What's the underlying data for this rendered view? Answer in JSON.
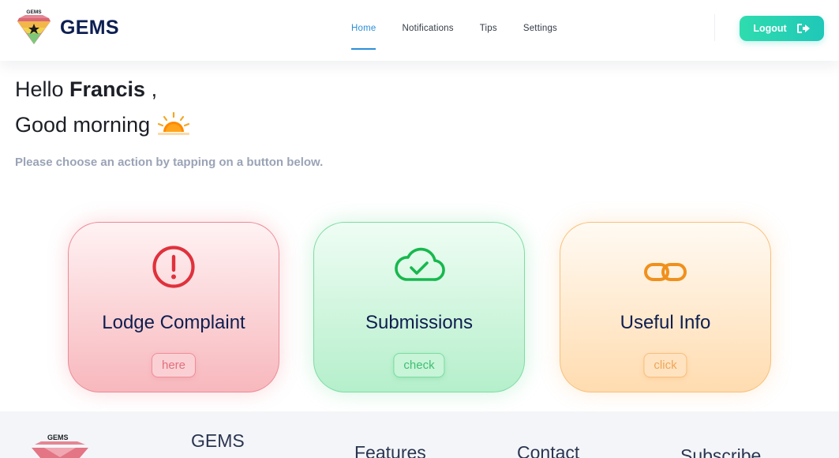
{
  "brand": {
    "logo_text": "GEMS",
    "name": "GEMS"
  },
  "nav": {
    "links": [
      {
        "label": "Home",
        "active": true
      },
      {
        "label": "Notifications",
        "active": false
      },
      {
        "label": "Tips",
        "active": false
      },
      {
        "label": "Settings",
        "active": false
      }
    ],
    "logout_label": "Logout",
    "logout_icon": "sign-out-icon"
  },
  "greeting": {
    "hello_prefix": "Hello ",
    "user_name": "Francis",
    "hello_suffix": " ,",
    "time_greeting": "Good morning",
    "time_icon": "sunrise-icon",
    "instruction": "Please choose an action by tapping on a button below."
  },
  "cards": [
    {
      "title": "Lodge Complaint",
      "button": "here",
      "icon": "exclamation-circle-icon",
      "accent": "#e8343f"
    },
    {
      "title": "Submissions",
      "button": "check",
      "icon": "cloud-check-icon",
      "accent": "#1fbf5a"
    },
    {
      "title": "Useful Info",
      "button": "click",
      "icon": "link-icon",
      "accent": "#f08c1a"
    }
  ],
  "footer": {
    "logo_text": "GEMS",
    "headings": [
      "GEMS",
      "Features",
      "Contact",
      "Subscribe"
    ]
  },
  "colors": {
    "brand_navy": "#0d1f52",
    "active_link": "#2b8fd8",
    "logout_gradient_start": "#2fdcae",
    "logout_gradient_end": "#1fc8b8",
    "muted_text": "#9aa3b6"
  }
}
